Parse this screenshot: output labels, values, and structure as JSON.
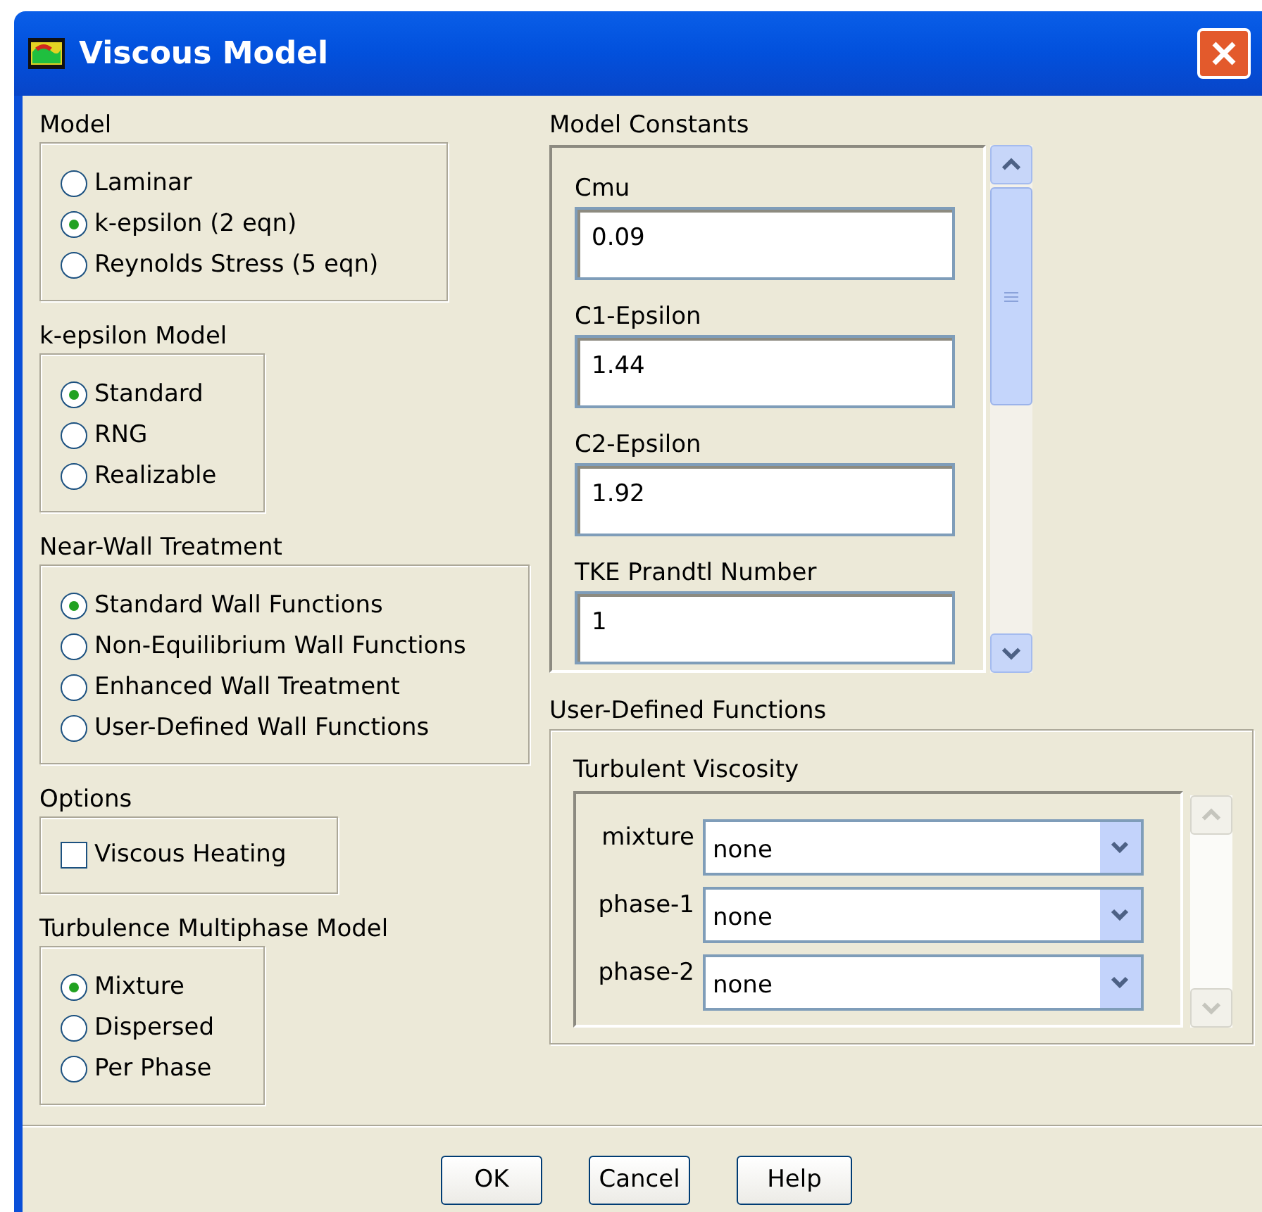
{
  "window": {
    "title": "Viscous Model"
  },
  "left_groups": [
    {
      "title": "Model",
      "kind": "radio",
      "options": [
        {
          "label": "Laminar",
          "selected": false
        },
        {
          "label": "k-epsilon (2 eqn)",
          "selected": true
        },
        {
          "label": "Reynolds Stress (5 eqn)",
          "selected": false
        }
      ]
    },
    {
      "title": "k-epsilon Model",
      "kind": "radio",
      "options": [
        {
          "label": "Standard",
          "selected": true
        },
        {
          "label": "RNG",
          "selected": false
        },
        {
          "label": "Realizable",
          "selected": false
        }
      ]
    },
    {
      "title": "Near-Wall Treatment",
      "kind": "radio",
      "options": [
        {
          "label": "Standard Wall Functions",
          "selected": true
        },
        {
          "label": "Non-Equilibrium Wall Functions",
          "selected": false
        },
        {
          "label": "Enhanced Wall Treatment",
          "selected": false
        },
        {
          "label": "User-Defined Wall Functions",
          "selected": false
        }
      ]
    },
    {
      "title": "Options",
      "kind": "checkbox",
      "options": [
        {
          "label": "Viscous Heating",
          "checked": false
        }
      ]
    },
    {
      "title": "Turbulence Multiphase Model",
      "kind": "radio",
      "options": [
        {
          "label": "Mixture",
          "selected": true
        },
        {
          "label": "Dispersed",
          "selected": false
        },
        {
          "label": "Per Phase",
          "selected": false
        }
      ]
    }
  ],
  "model_constants": {
    "title": "Model Constants",
    "fields": [
      {
        "label": "Cmu",
        "value": "0.09"
      },
      {
        "label": "C1-Epsilon",
        "value": "1.44"
      },
      {
        "label": "C2-Epsilon",
        "value": "1.92"
      },
      {
        "label": "TKE Prandtl Number",
        "value": "1"
      }
    ]
  },
  "user_defined_functions": {
    "title": "User-Defined Functions",
    "turbulent_viscosity": {
      "title": "Turbulent Viscosity",
      "rows": [
        {
          "label": "mixture",
          "value": "none"
        },
        {
          "label": "phase-1",
          "value": "none"
        },
        {
          "label": "phase-2",
          "value": "none"
        }
      ]
    }
  },
  "buttons": [
    {
      "label": "OK"
    },
    {
      "label": "Cancel"
    },
    {
      "label": "Help"
    }
  ]
}
